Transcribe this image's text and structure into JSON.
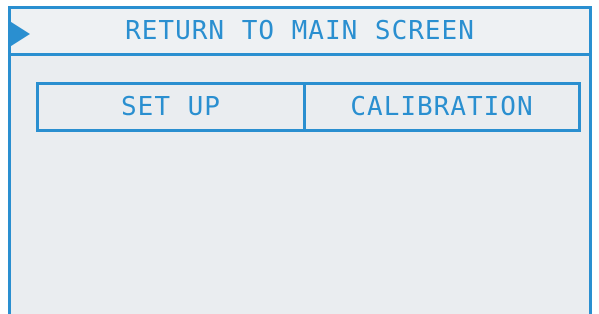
{
  "header": {
    "return_label": "RETURN TO MAIN SCREEN"
  },
  "menu": {
    "tabs": [
      {
        "label": "SET UP"
      },
      {
        "label": "CALIBRATION"
      }
    ]
  },
  "colors": {
    "accent": "#2a8fd0",
    "background": "#eaedf0"
  },
  "icons": {
    "selector": "selector-arrow-icon"
  }
}
